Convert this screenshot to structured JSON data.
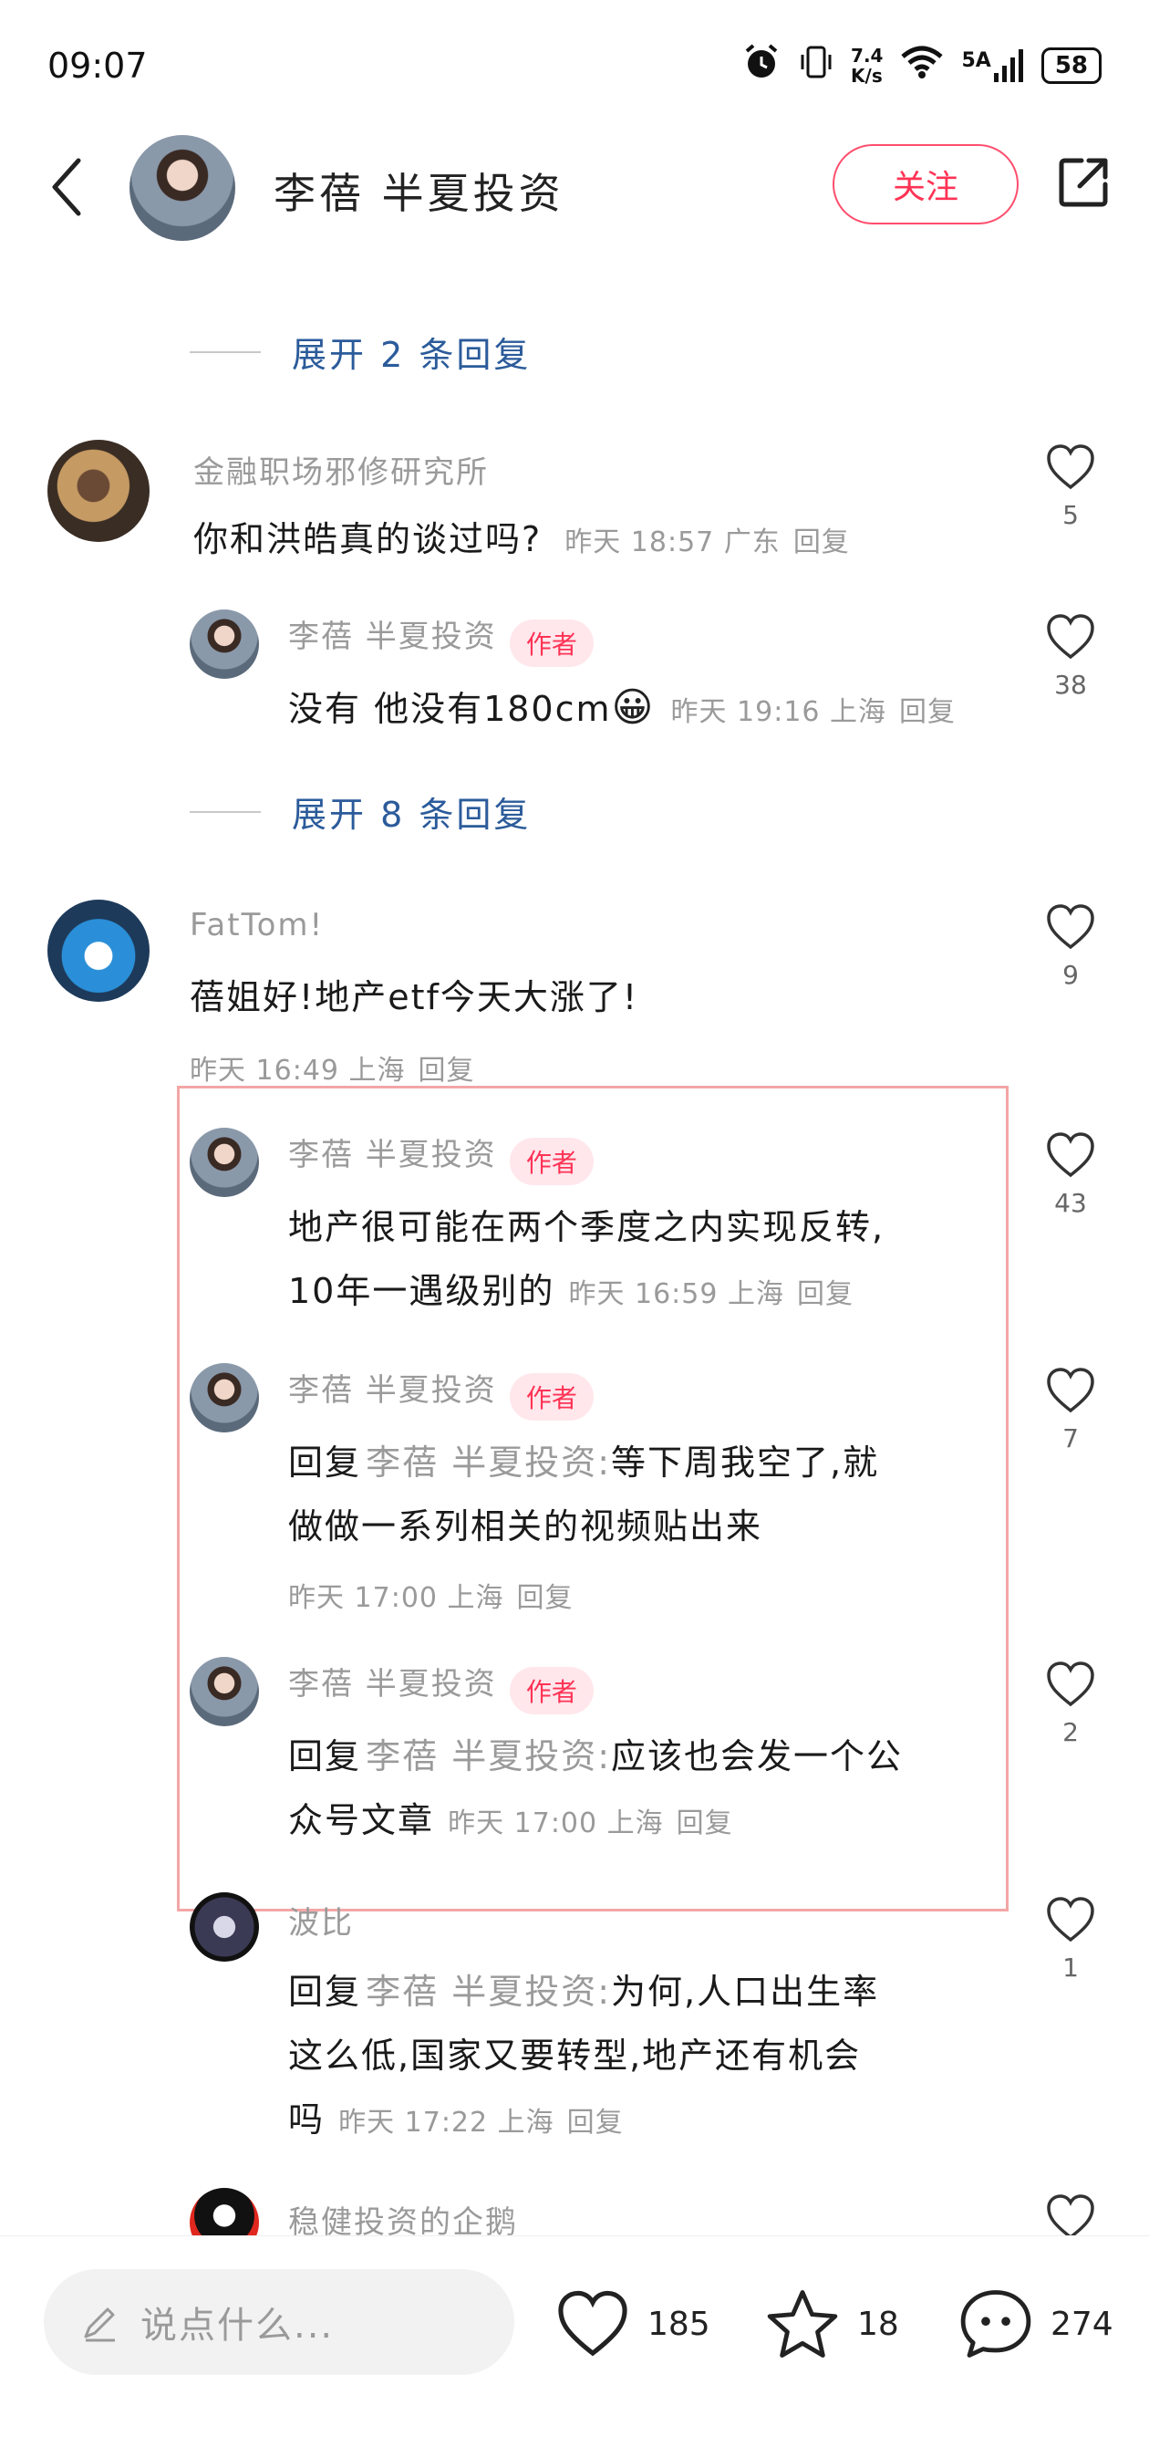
{
  "status_bar": {
    "time": "09:07",
    "net_speed_top": "7.4",
    "net_speed_bottom": "K/s",
    "signal": "5A",
    "battery": "58"
  },
  "header": {
    "title": "李蓓 半夏投资",
    "follow_label": "关注"
  },
  "thread": [
    {
      "expand_label": "展开 2 条回复"
    },
    {
      "expand_label": "展开 8 条回复"
    }
  ],
  "comments": [
    {
      "user": "金融职场邪修研究所",
      "text": "你和洪皓真的谈过吗?",
      "time": "昨天 18:57",
      "location": "广东",
      "reply_label": "回复",
      "likes": "5"
    },
    {
      "user": "李蓓 半夏投资",
      "tag": "作者",
      "text": "没有 他没有180cm",
      "emoji": "😀",
      "time": "昨天 19:16",
      "location": "上海",
      "reply_label": "回复",
      "likes": "38"
    },
    {
      "user": "FatTom!",
      "text": "蓓姐好!地产etf今天大涨了!",
      "time": "昨天 16:49",
      "location": "上海",
      "reply_label": "回复",
      "likes": "9"
    },
    {
      "user": "李蓓 半夏投资",
      "tag": "作者",
      "text_line1": "地产很可能在两个季度之内实现反转,",
      "text_line2": "10年一遇级别的",
      "time": "昨天 16:59",
      "location": "上海",
      "reply_label": "回复",
      "likes": "43"
    },
    {
      "user": "李蓓 半夏投资",
      "tag": "作者",
      "reply_prefix": "回复",
      "reply_to": "李蓓 半夏投资:",
      "text_line1": "等下周我空了,就",
      "text_line2": "做做一系列相关的视频贴出来",
      "time": "昨天 17:00",
      "location": "上海",
      "reply_label": "回复",
      "likes": "7"
    },
    {
      "user": "李蓓 半夏投资",
      "tag": "作者",
      "reply_prefix": "回复",
      "reply_to": "李蓓 半夏投资:",
      "text_line1": "应该也会发一个公",
      "text_line2": "众号文章",
      "time": "昨天 17:00",
      "location": "上海",
      "reply_label": "回复",
      "likes": "2"
    },
    {
      "user": "波比",
      "reply_prefix": "回复",
      "reply_to": "李蓓 半夏投资:",
      "text_line1": "为何,人口出生率",
      "text_line2": "这么低,国家又要转型,地产还有机会",
      "text_line3": "吗",
      "time": "昨天 17:22",
      "location": "上海",
      "reply_label": "回复",
      "likes": "1"
    },
    {
      "user": "稳健投资的企鹅"
    }
  ],
  "bottom_bar": {
    "input_placeholder": "说点什么...",
    "likes": "185",
    "favorites": "18",
    "comments": "274"
  },
  "colors": {
    "accent": "#ff3355",
    "link": "#2b5b9a",
    "highlight_border": "#f3a6a6"
  }
}
